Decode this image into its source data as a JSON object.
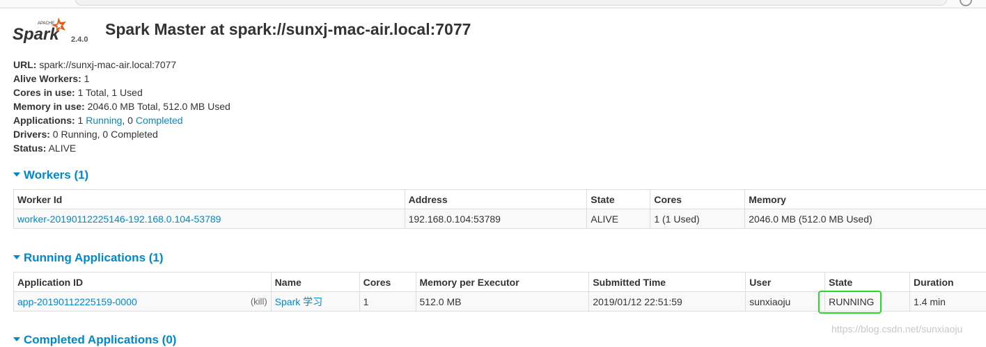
{
  "header": {
    "logo_brand": "Spark",
    "logo_apache": "APACHE",
    "version": "2.4.0",
    "title": "Spark Master at spark://sunxj-mac-air.local:7077"
  },
  "summary": {
    "url_label": "URL:",
    "url_value": " spark://sunxj-mac-air.local:7077",
    "workers_label": "Alive Workers:",
    "workers_value": " 1",
    "cores_label": "Cores in use:",
    "cores_value": " 1 Total, 1 Used",
    "memory_label": "Memory in use:",
    "memory_value": " 2046.0 MB Total, 512.0 MB Used",
    "apps_label": "Applications:",
    "apps_running_count": " 1 ",
    "apps_running_link": "Running",
    "apps_sep": ", 0 ",
    "apps_completed_link": "Completed",
    "drivers_label": "Drivers:",
    "drivers_value": " 0 Running, 0 Completed",
    "status_label": "Status:",
    "status_value": " ALIVE"
  },
  "workers": {
    "heading": "Workers (1)",
    "columns": [
      "Worker Id",
      "Address",
      "State",
      "Cores",
      "Memory"
    ],
    "rows": [
      {
        "id": "worker-20190112225146-192.168.0.104-53789",
        "address": "192.168.0.104:53789",
        "state": "ALIVE",
        "cores": "1 (1 Used)",
        "memory": "2046.0 MB (512.0 MB Used)"
      }
    ]
  },
  "running_apps": {
    "heading": "Running Applications (1)",
    "columns": [
      "Application ID",
      "Name",
      "Cores",
      "Memory per Executor",
      "Submitted Time",
      "User",
      "State",
      "Duration"
    ],
    "rows": [
      {
        "id": "app-20190112225159-0000",
        "kill": "(kill)",
        "name": "Spark 学习",
        "cores": "1",
        "memory": "512.0 MB",
        "submitted": "2019/01/12 22:51:59",
        "user": "sunxiaoju",
        "state": "RUNNING",
        "duration": "1.4 min"
      }
    ]
  },
  "completed_apps": {
    "heading": "Completed Applications (0)"
  },
  "watermark": "https://blog.csdn.net/sunxiaoju",
  "colors": {
    "link": "#0088cc",
    "highlight": "#22dd22",
    "text": "#333333"
  }
}
